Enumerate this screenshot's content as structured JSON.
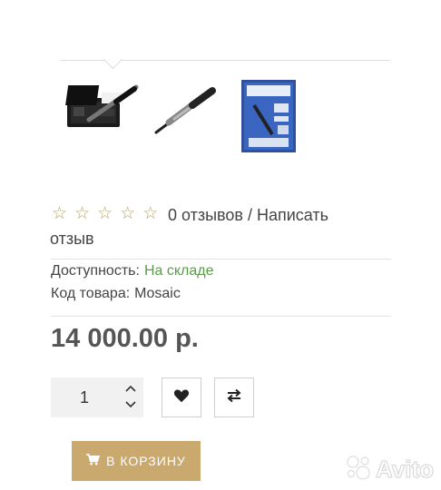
{
  "gallery": {
    "thumbnails": [
      {
        "icon": "tattoo-kit-case-image"
      },
      {
        "icon": "tattoo-pen-image"
      },
      {
        "icon": "product-brochure-image"
      }
    ]
  },
  "rating": {
    "stars_filled": 0,
    "stars_total": 5,
    "reviews_text": "0 отзывов / Написать отзыв"
  },
  "availability": {
    "label": "Доступность:",
    "value": "На складе"
  },
  "sku": {
    "label": "Код товара:",
    "value": "Mosaic"
  },
  "price": "14 000.00 р.",
  "quantity": {
    "value": "1",
    "increment_icon": "chevron-up-icon",
    "decrement_icon": "chevron-down-icon"
  },
  "actions": {
    "wishlist_icon": "heart-icon",
    "compare_icon": "compare-arrows-icon",
    "cart_label": "В КОРЗИНУ",
    "cart_icon": "shopping-cart-icon"
  },
  "watermark": {
    "text": "Avito"
  },
  "colors": {
    "accent": "#c9a96e",
    "in_stock": "#5a9a4a",
    "star": "#b9a46a"
  }
}
